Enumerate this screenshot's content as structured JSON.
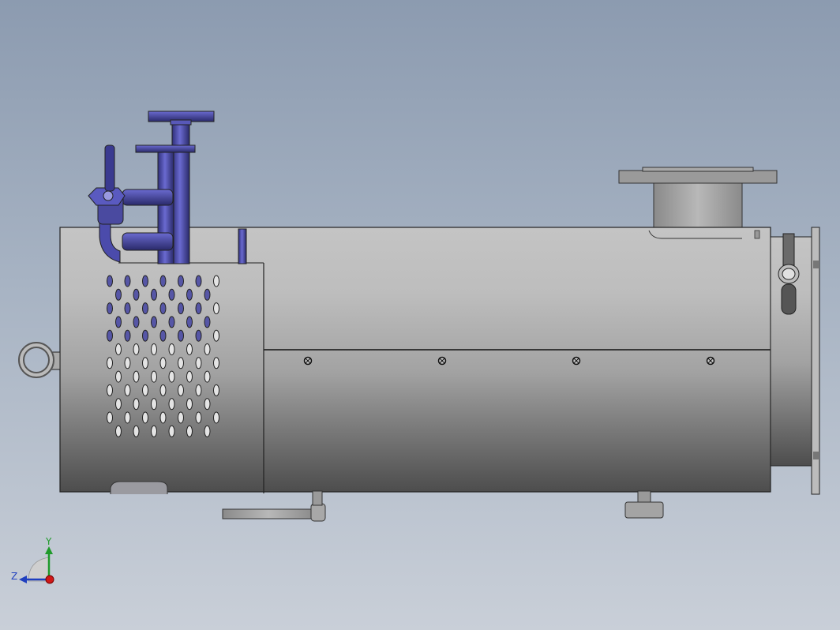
{
  "viewport": {
    "background_top": "#8c9bb0",
    "background_bottom": "#c9cfd8"
  },
  "model": {
    "shell_color": "#b4b4b4",
    "pipe_color": "#4a4aa8",
    "perforation_rows": 12,
    "perforation_cols": 7,
    "screw_count": 4
  },
  "triad": {
    "x_label": "",
    "y_label": "Y",
    "z_label": "Z",
    "y_color": "#1f9a2a",
    "z_color": "#1f3fbf",
    "x_color": "#d01818"
  }
}
